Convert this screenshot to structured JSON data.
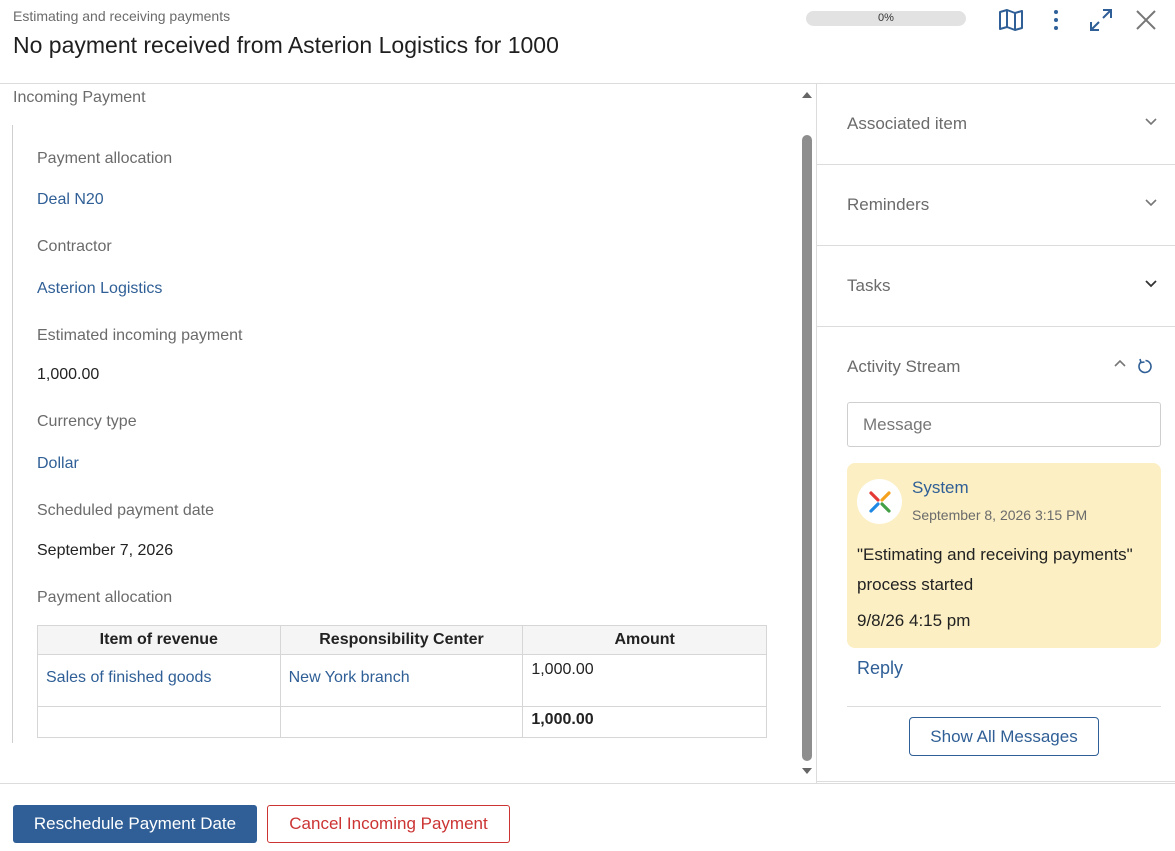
{
  "header": {
    "breadcrumb": "Estimating and receiving payments",
    "title": "No payment received from Asterion Logistics for 1000",
    "progress": {
      "percent": 0,
      "label": "0%"
    },
    "icons": [
      "map-icon",
      "more-vertical-icon",
      "expand-icon",
      "close-icon"
    ]
  },
  "form": {
    "section_title": "Incoming Payment",
    "fields": [
      {
        "label": "Payment allocation",
        "value": "Deal N20",
        "is_link": true
      },
      {
        "label": "Contractor",
        "value": "Asterion Logistics",
        "is_link": true
      },
      {
        "label": "Estimated incoming payment",
        "value": "1,000.00",
        "is_link": false
      },
      {
        "label": "Currency type",
        "value": "Dollar",
        "is_link": true
      },
      {
        "label": "Scheduled payment date",
        "value": "September 7, 2026",
        "is_link": false
      }
    ],
    "allocation_table": {
      "label": "Payment allocation",
      "columns": [
        "Item of revenue",
        "Responsibility Center",
        "Amount"
      ],
      "rows": [
        {
          "item": "Sales of finished goods",
          "center": "New York branch",
          "amount": "1,000.00"
        }
      ],
      "total": "1,000.00"
    }
  },
  "sidebar": {
    "sections": [
      {
        "label": "Associated item"
      },
      {
        "label": "Reminders"
      },
      {
        "label": "Tasks"
      }
    ],
    "activity_stream": {
      "title": "Activity Stream",
      "message_placeholder": "Message",
      "entries": [
        {
          "author": "System",
          "timestamp": "September 8, 2026 3:15 PM",
          "text": "\"Estimating and receiving payments\" process started",
          "time": "9/8/26 4:15 pm"
        }
      ],
      "reply_label": "Reply",
      "show_all_label": "Show All Messages"
    }
  },
  "footer": {
    "primary_label": "Reschedule Payment Date",
    "secondary_label": "Cancel Incoming Payment"
  },
  "colors": {
    "accent": "#2f5f96",
    "danger": "#cc3333",
    "card_bg": "#fbefc3"
  }
}
